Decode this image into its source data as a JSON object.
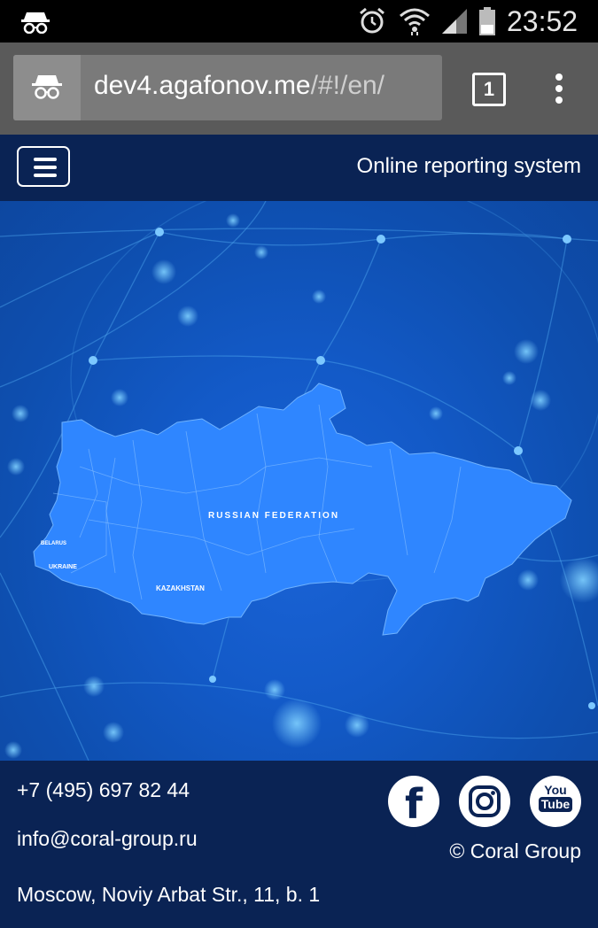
{
  "status_bar": {
    "time": "23:52",
    "icons": [
      "incognito-icon",
      "alarm-icon",
      "wifi-icon",
      "signal-icon",
      "battery-icon"
    ]
  },
  "browser": {
    "url_host": "dev4.agafonov.me",
    "url_path": "/#!/en/",
    "tab_count": "1",
    "icons": [
      "incognito-icon",
      "tabs-icon",
      "overflow-menu-icon"
    ]
  },
  "header": {
    "menu_icon": "hamburger-menu-icon",
    "title": "Online reporting system"
  },
  "map": {
    "labels": [
      "RUSSIAN FEDERATION",
      "BELARUS",
      "UKRAINE",
      "KAZAKHSTAN"
    ],
    "colors": {
      "land": "#2f86ff",
      "background": "#135ac8",
      "network": "#4fb3ff"
    }
  },
  "footer": {
    "phone": "+7 (495) 697 82 44",
    "email": "info@coral-group.ru",
    "address": "Moscow, Noviy Arbat Str., 11, b. 1",
    "copyright": "© Coral Group",
    "social": {
      "facebook": "f",
      "youtube_top": "You",
      "youtube_bottom": "Tube",
      "icons": [
        "facebook-icon",
        "instagram-icon",
        "youtube-icon"
      ]
    }
  },
  "colors": {
    "header_bg": "#0a2354",
    "status_bg": "#000000",
    "browser_bg": "#5a5a5a"
  }
}
